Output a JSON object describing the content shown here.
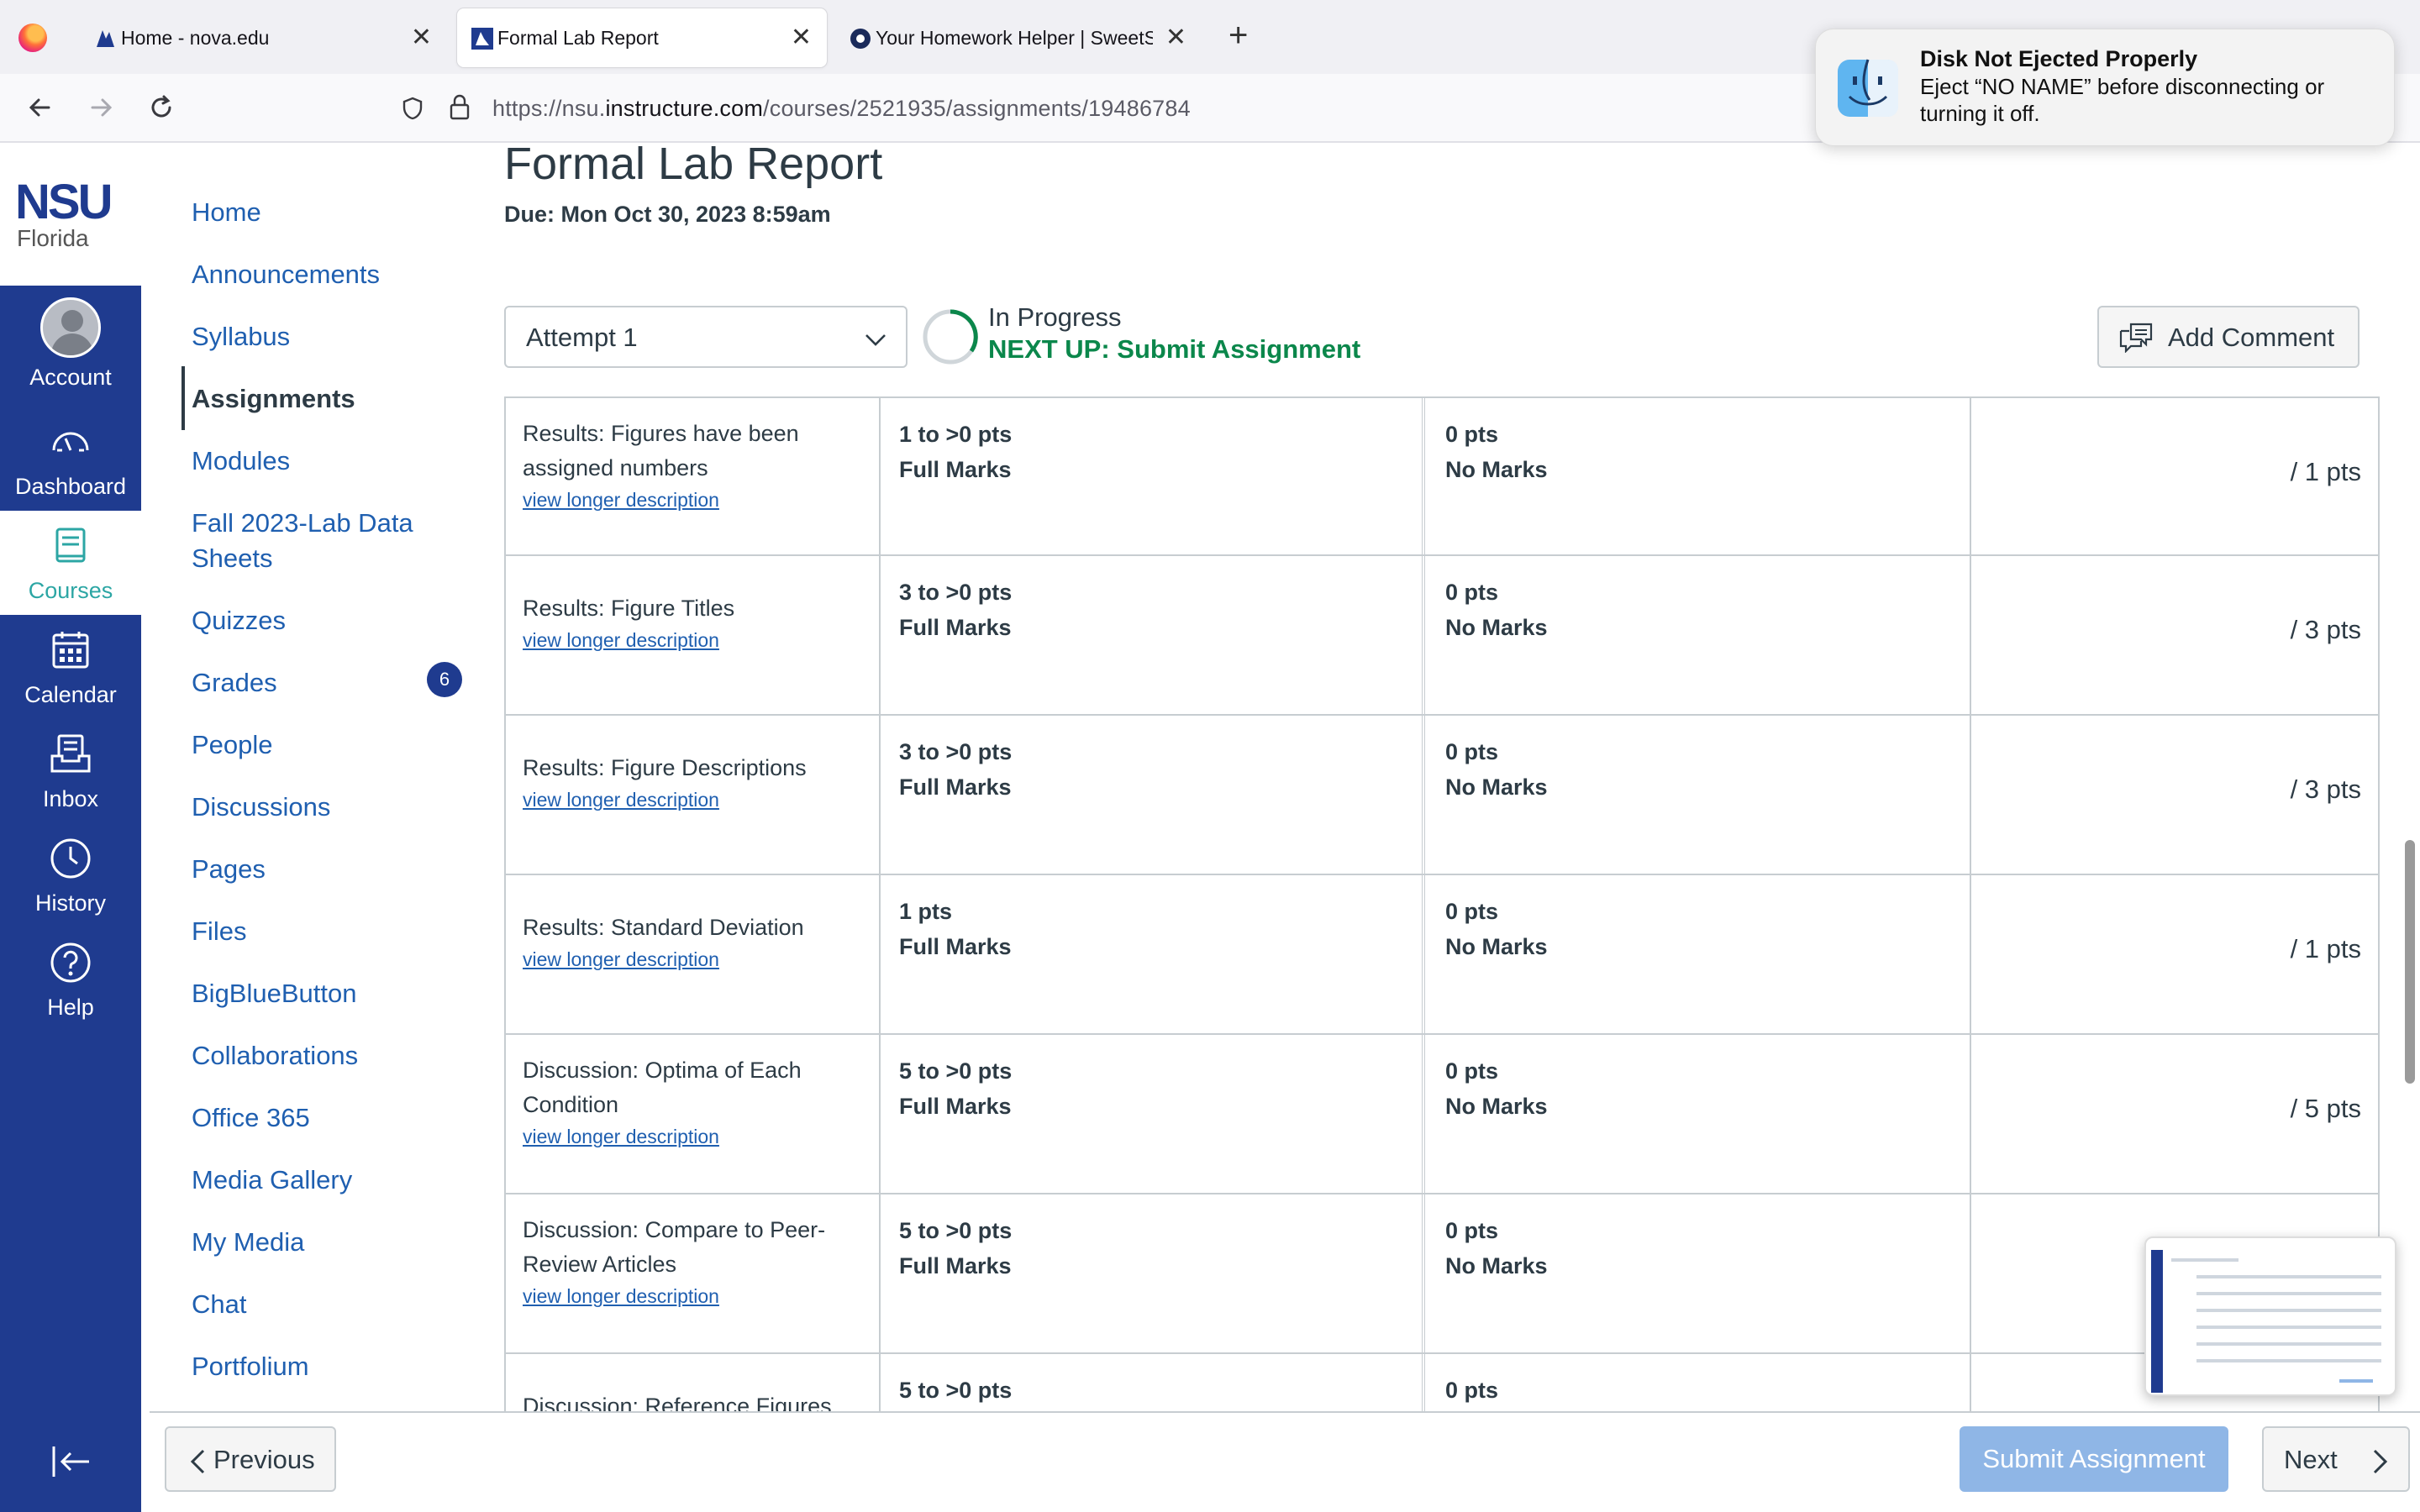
{
  "browser": {
    "tabs": [
      {
        "label": "Home - nova.edu",
        "active": false
      },
      {
        "label": "Formal Lab Report",
        "active": true
      },
      {
        "label": "Your Homework Helper | SweetS",
        "active": false
      }
    ],
    "url_prefix": "https://nsu.",
    "url_host": "instructure.com",
    "url_path": "/courses/2521935/assignments/19486784"
  },
  "notification": {
    "title": "Disk Not Ejected Properly",
    "body": "Eject “NO NAME” before disconnecting or turning it off."
  },
  "logo": {
    "line1": "NSU",
    "line2": "Florida"
  },
  "global_nav": {
    "account": "Account",
    "dashboard": "Dashboard",
    "courses": "Courses",
    "calendar": "Calendar",
    "inbox": "Inbox",
    "history": "History",
    "help": "Help"
  },
  "course_nav": {
    "items": [
      "Home",
      "Announcements",
      "Syllabus",
      "Assignments",
      "Modules",
      "Fall 2023-Lab Data Sheets",
      "Quizzes",
      "Grades",
      "People",
      "Discussions",
      "Pages",
      "Files",
      "BigBlueButton",
      "Collaborations",
      "Office 365",
      "Media Gallery",
      "My Media",
      "Chat",
      "Portfolium"
    ],
    "active": "Assignments",
    "grades_badge": "6"
  },
  "assignment": {
    "title": "Formal Lab Report",
    "due": "Due: Mon Oct 30, 2023 8:59am",
    "attempt": "Attempt 1",
    "status": "In Progress",
    "next_up": "NEXT UP: Submit Assignment",
    "add_comment": "Add Comment"
  },
  "rubric": {
    "long_desc_link": "view longer description",
    "rows": [
      {
        "criterion": "Results: Figures have been assigned numbers",
        "full_pts": "1 to >0 pts",
        "full_label": "Full Marks",
        "no_pts": "0 pts",
        "no_label": "No Marks",
        "total": "/ 1 pts"
      },
      {
        "criterion": "Results: Figure Titles",
        "full_pts": "3 to >0 pts",
        "full_label": "Full Marks",
        "no_pts": "0 pts",
        "no_label": "No Marks",
        "total": "/ 3 pts"
      },
      {
        "criterion": "Results: Figure Descriptions",
        "full_pts": "3 to >0 pts",
        "full_label": "Full Marks",
        "no_pts": "0 pts",
        "no_label": "No Marks",
        "total": "/ 3 pts"
      },
      {
        "criterion": "Results: Standard Deviation",
        "full_pts": "1 pts",
        "full_label": "Full Marks",
        "no_pts": "0 pts",
        "no_label": "No Marks",
        "total": "/ 1 pts"
      },
      {
        "criterion": "Discussion: Optima of Each Condition",
        "full_pts": "5 to >0 pts",
        "full_label": "Full Marks",
        "no_pts": "0 pts",
        "no_label": "No Marks",
        "total": "/ 5 pts"
      },
      {
        "criterion": "Discussion: Compare to Peer-Review Articles",
        "full_pts": "5 to >0 pts",
        "full_label": "Full Marks",
        "no_pts": "0 pts",
        "no_label": "No Marks",
        "total": ""
      },
      {
        "criterion": "Discussion: Reference Figures",
        "full_pts": "5 to >0 pts",
        "full_label": "",
        "no_pts": "0 pts",
        "no_label": "",
        "total": ""
      }
    ]
  },
  "footer": {
    "previous": "Previous",
    "submit": "Submit Assignment",
    "next": "Next"
  },
  "colors": {
    "global_nav_bg": "#1f3b8f",
    "link": "#1f5fb0",
    "courses_accent": "#2ca6a4",
    "next_up_green": "#0b874b",
    "submit_disabled": "#8fb6e6"
  }
}
